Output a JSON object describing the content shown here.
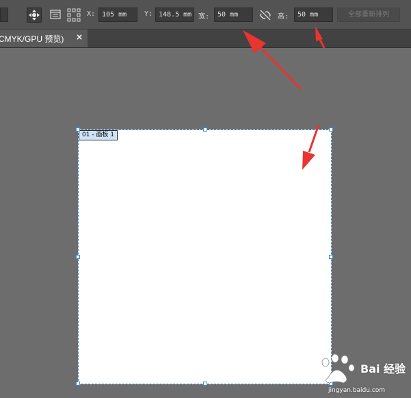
{
  "toolbar": {
    "x_label": "X:",
    "x_value": "105 mm",
    "y_label": "Y:",
    "y_value": "148.5 mm",
    "width_label": "宽:",
    "width_value": "50 mm",
    "height_label": "高:",
    "height_value": "50 mm",
    "rearrange_all_label": "全部重新排列",
    "icons": [
      "move-artboard-icon",
      "artboard-options-icon",
      "grid-icon",
      "link-constrain-icon"
    ]
  },
  "tab": {
    "title": "CMYK/GPU 预览)",
    "close": "×"
  },
  "artboard": {
    "label": "01 - 画板 1"
  },
  "watermark": {
    "brand": "Bai 经验",
    "url": "jingyan.baidu.com"
  },
  "colors": {
    "accent": "#3e8ad6",
    "arrow": "#e8352f"
  }
}
